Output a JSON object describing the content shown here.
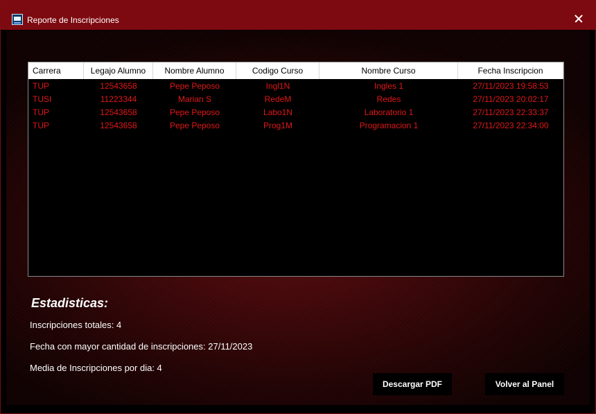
{
  "window": {
    "title": "Reporte de Inscripciones"
  },
  "table": {
    "columns": [
      "Carrera",
      "Legajo Alumno",
      "Nombre Alumno",
      "Codigo Curso",
      "Nombre Curso",
      "Fecha Inscripcion"
    ],
    "rows": [
      [
        "TUP",
        "12543658",
        "Pepe Peposo",
        "Ingl1N",
        "Ingles 1",
        "27/11/2023 19:58:53"
      ],
      [
        "TUSI",
        "11223344",
        "Marian S",
        "RedeM",
        "Redes",
        "27/11/2023 20:02:17"
      ],
      [
        "TUP",
        "12543658",
        "Pepe Peposo",
        "Labo1N",
        "Laboratorio 1",
        "27/11/2023 22:33:37"
      ],
      [
        "TUP",
        "12543658",
        "Pepe Peposo",
        "Prog1M",
        "Programacion 1",
        "27/11/2023 22:34:00"
      ]
    ]
  },
  "stats": {
    "heading": "Estadisticas:",
    "total": "Inscripciones totales: 4",
    "peak_date": "Fecha con mayor cantidad de inscripciones: 27/11/2023",
    "daily_mean": "Media de Inscripciones por dia: 4"
  },
  "buttons": {
    "download_pdf": "Descargar PDF",
    "back_to_panel": "Volver al Panel"
  },
  "colors": {
    "titlebar": "#7d0a10",
    "row_text": "#e01818",
    "grid_bg": "#000000"
  }
}
